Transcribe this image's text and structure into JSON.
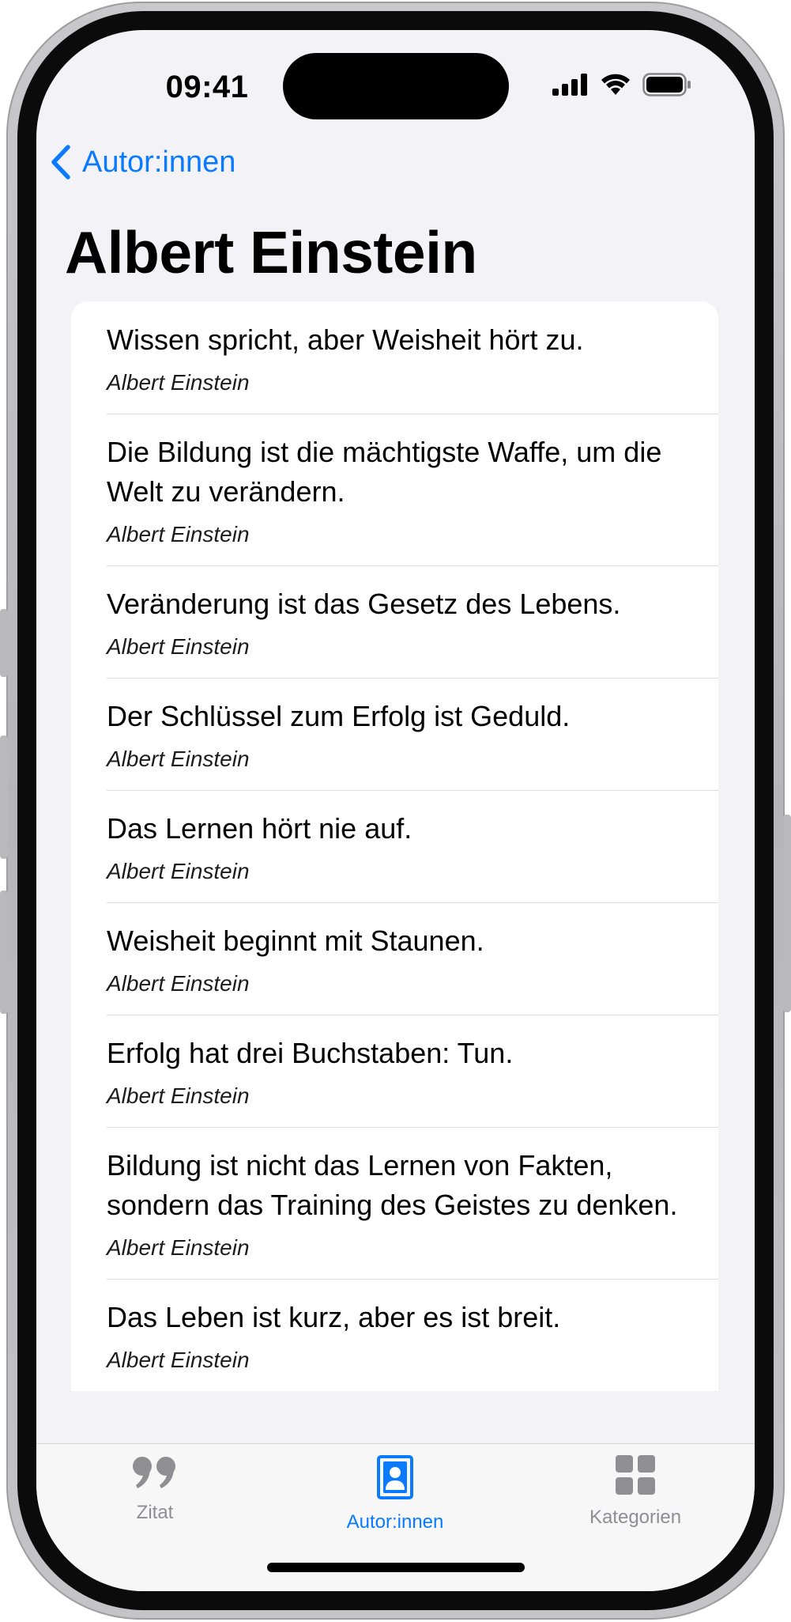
{
  "status_bar": {
    "time": "09:41"
  },
  "nav": {
    "back_label": "Autor:innen",
    "title": "Albert Einstein"
  },
  "quotes": [
    {
      "text": "Wissen spricht, aber Weisheit hört zu.",
      "author": "Albert Einstein"
    },
    {
      "text": "Die Bildung ist die mächtigste Waffe, um die Welt zu verändern.",
      "author": "Albert Einstein"
    },
    {
      "text": "Veränderung ist das Gesetz des Lebens.",
      "author": "Albert Einstein"
    },
    {
      "text": "Der Schlüssel zum Erfolg ist Geduld.",
      "author": "Albert Einstein"
    },
    {
      "text": "Das Lernen hört nie auf.",
      "author": "Albert Einstein"
    },
    {
      "text": "Weisheit beginnt mit Staunen.",
      "author": "Albert Einstein"
    },
    {
      "text": "Erfolg hat drei Buchstaben: Tun.",
      "author": "Albert Einstein"
    },
    {
      "text": "Bildung ist nicht das Lernen von Fakten, sondern das Training des Geistes zu denken.",
      "author": "Albert Einstein"
    },
    {
      "text": "Das Leben ist kurz, aber es ist breit.",
      "author": "Albert Einstein"
    }
  ],
  "tabs": [
    {
      "label": "Zitat",
      "icon": "quote-icon",
      "selected": false
    },
    {
      "label": "Autor:innen",
      "icon": "person-portrait-icon",
      "selected": true
    },
    {
      "label": "Kategorien",
      "icon": "grid-icon",
      "selected": false
    }
  ],
  "colors": {
    "accent": "#0a7aff",
    "inactive": "#8e8e93",
    "background": "#f2f2f7"
  }
}
